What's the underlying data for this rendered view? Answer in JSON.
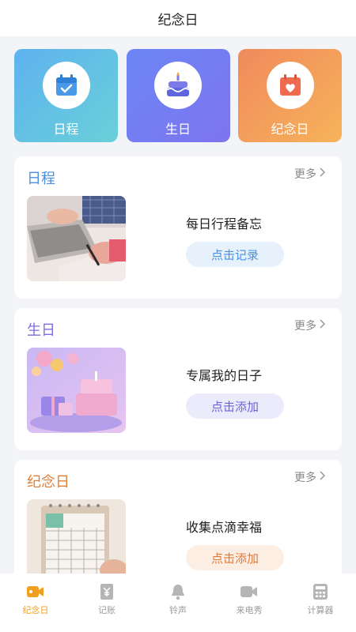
{
  "header": {
    "title": "纪念日"
  },
  "quick_buttons": [
    {
      "label": "日程",
      "icon": "calendar-check-icon"
    },
    {
      "label": "生日",
      "icon": "birthday-cake-icon"
    },
    {
      "label": "纪念日",
      "icon": "calendar-heart-icon"
    }
  ],
  "cards": [
    {
      "title": "日程",
      "more": "更多",
      "desc": "每日行程备忘",
      "action": "点击记录",
      "title_color": "#4a8fe0",
      "action_color": "#4a8fe0",
      "action_bg": "#e6f1fc"
    },
    {
      "title": "生日",
      "more": "更多",
      "desc": "专属我的日子",
      "action": "点击添加",
      "title_color": "#7b6fe0",
      "action_color": "#6b63d6",
      "action_bg": "#ecebfb"
    },
    {
      "title": "纪念日",
      "more": "更多",
      "desc": "收集点滴幸福",
      "action": "点击添加",
      "title_color": "#e0803a",
      "action_color": "#e07a3a",
      "action_bg": "#fdeee4"
    }
  ],
  "tabbar": [
    {
      "label": "纪念日",
      "icon": "video-camera-icon",
      "active": true
    },
    {
      "label": "记账",
      "icon": "yen-note-icon",
      "active": false
    },
    {
      "label": "铃声",
      "icon": "bell-icon",
      "active": false
    },
    {
      "label": "来电秀",
      "icon": "video-call-icon",
      "active": false
    },
    {
      "label": "计算器",
      "icon": "calculator-icon",
      "active": false
    }
  ],
  "colors": {
    "accent": "#f0a020",
    "inactive": "#9a9a9a"
  }
}
